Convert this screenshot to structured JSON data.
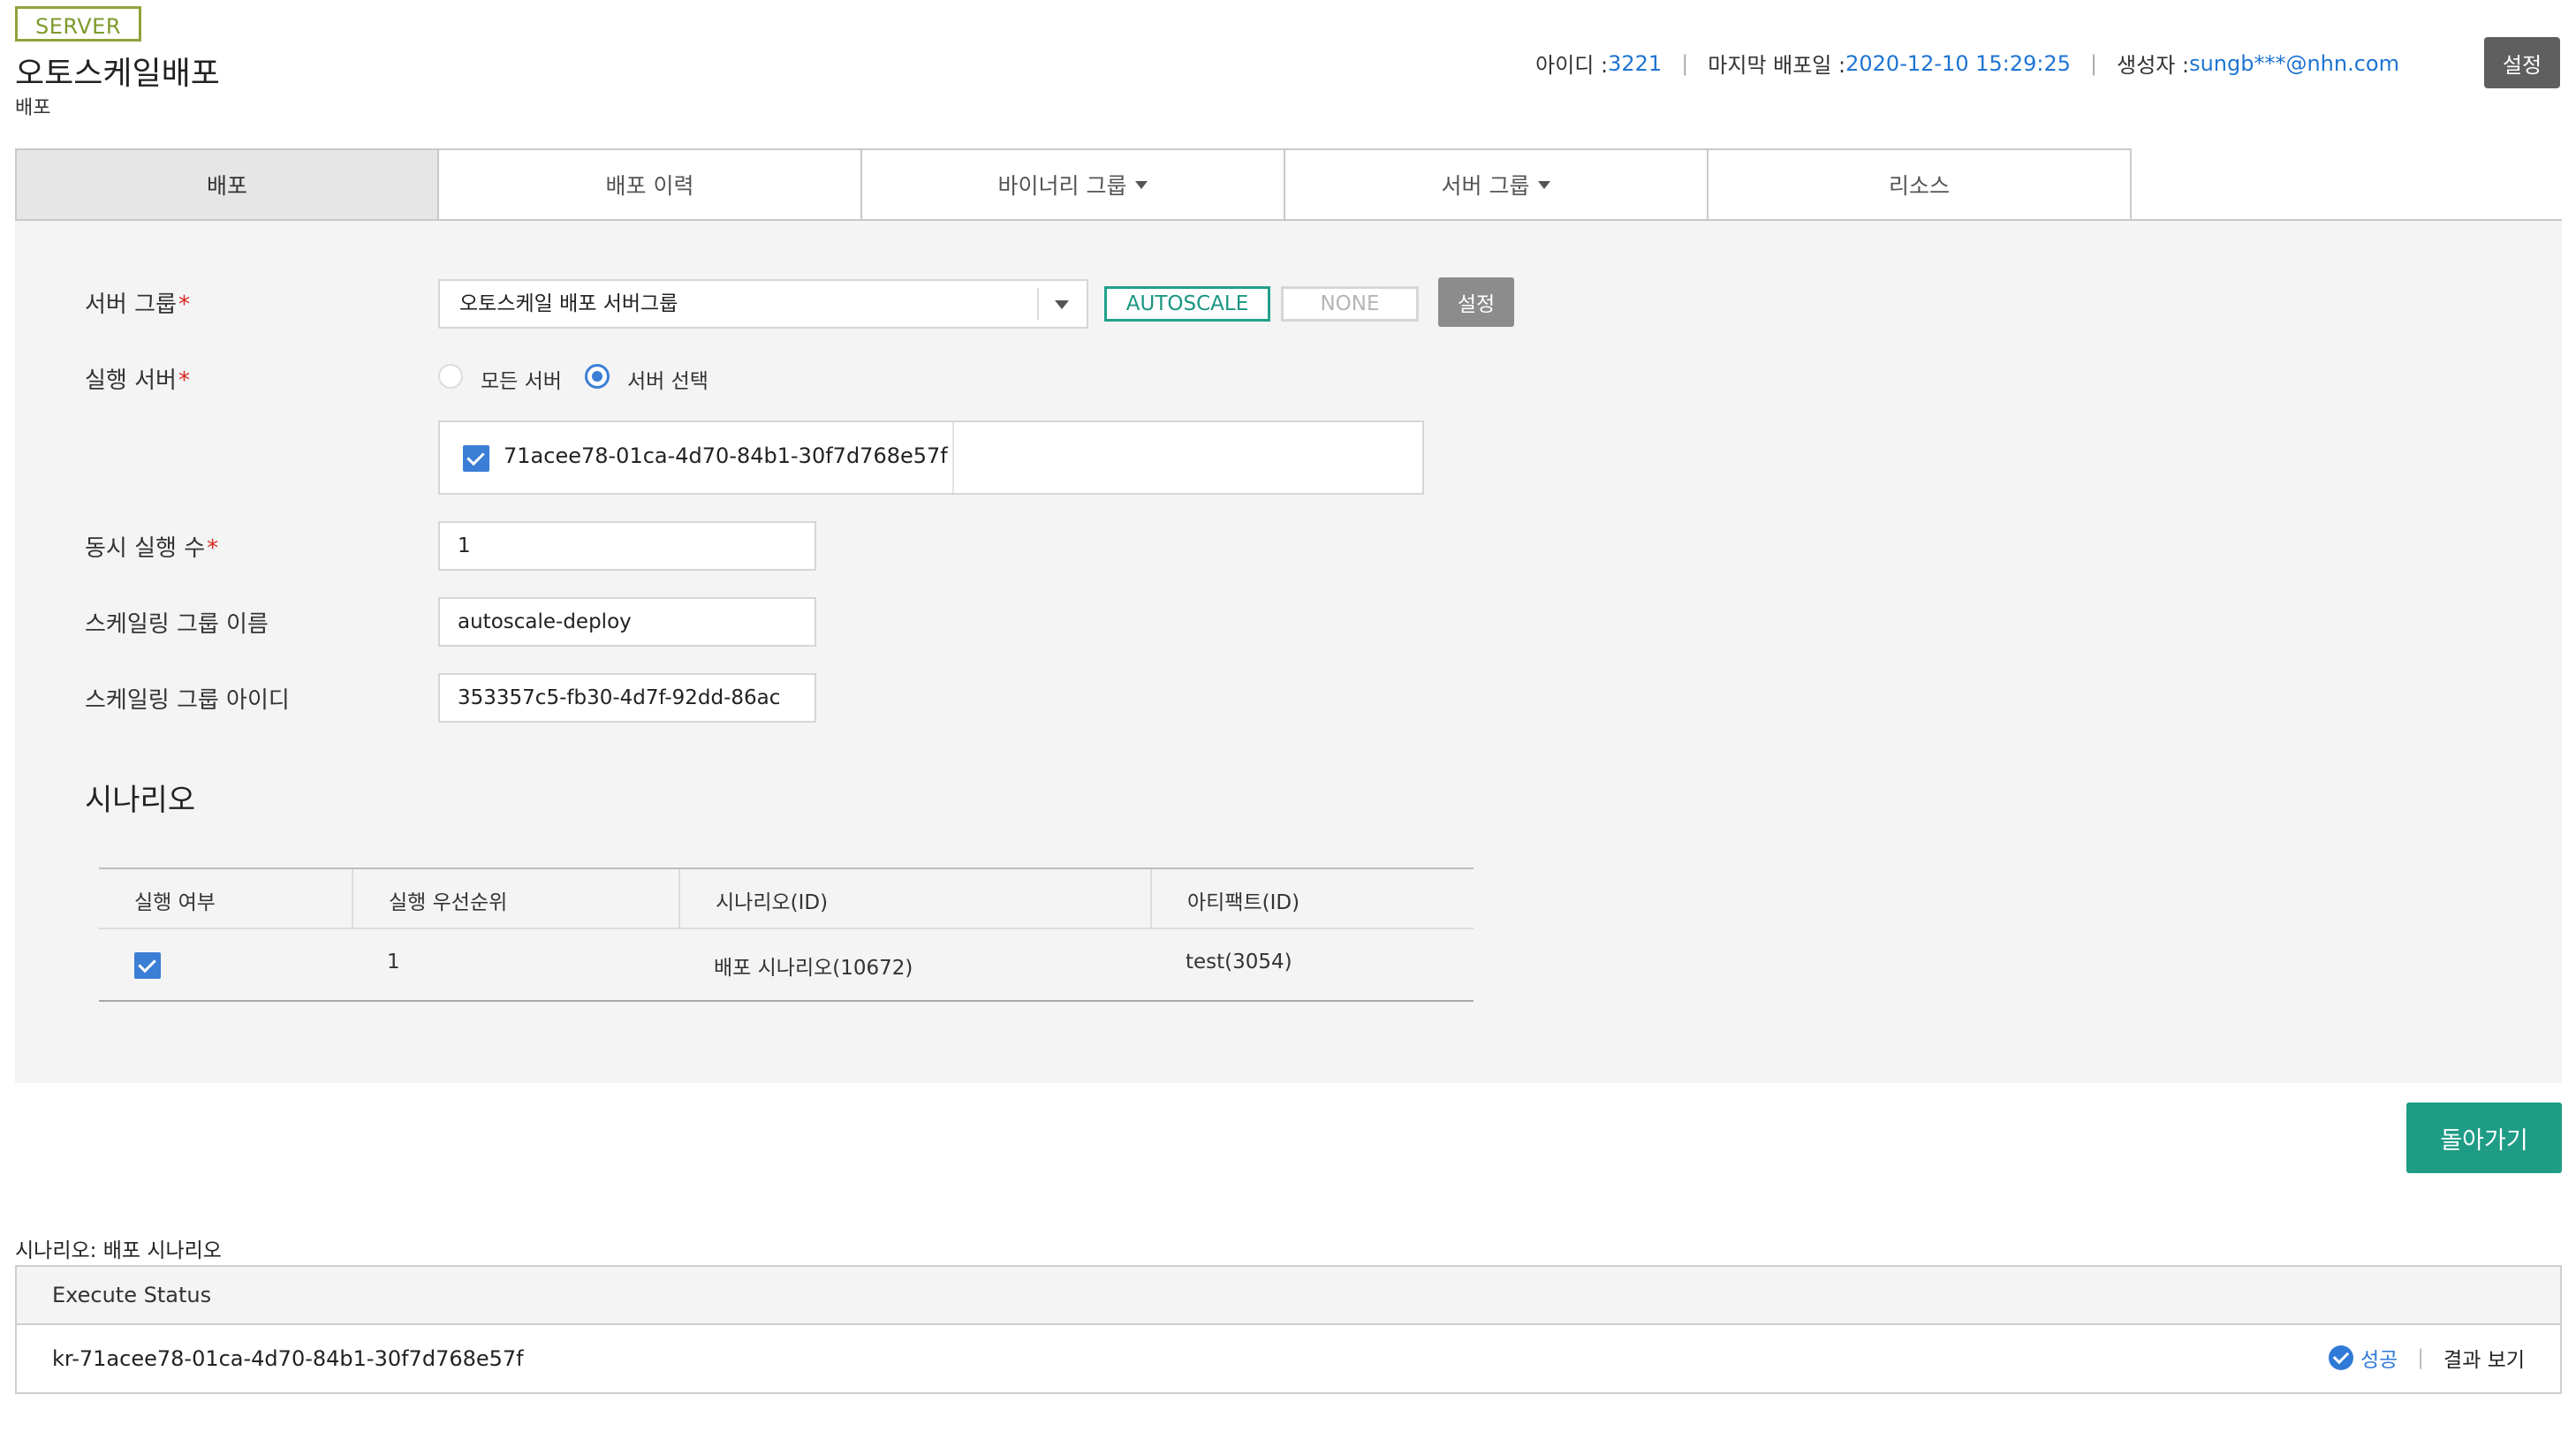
{
  "header": {
    "badge": "SERVER",
    "title": "오토스케일배포",
    "subtitle": "배포",
    "meta": {
      "id_label": "아이디 : ",
      "id_value": "3221",
      "last_deploy_label": "마지막 배포일 : ",
      "last_deploy_value": "2020-12-10 15:29:25",
      "creator_label": "생성자 : ",
      "creator_value": "sungb***@nhn.com"
    },
    "settings_label": "설정"
  },
  "tabs": [
    {
      "label": "배포"
    },
    {
      "label": "배포 이력"
    },
    {
      "label": "바이너리 그룹"
    },
    {
      "label": "서버 그룹"
    },
    {
      "label": "리소스"
    }
  ],
  "form": {
    "server_group_label": "서버 그룹",
    "server_group_value": "오토스케일 배포 서버그룹",
    "autoscale_label": "AUTOSCALE",
    "none_label": "NONE",
    "set_label": "설정",
    "exec_server_label": "실행 서버",
    "radio_all": "모든 서버",
    "radio_select": "서버 선택",
    "server_id": "71acee78-01ca-4d70-84b1-30f7d768e57f",
    "concurrency_label": "동시 실행 수",
    "concurrency_value": "1",
    "scaling_name_label": "스케일링 그룹 이름",
    "scaling_name_value": "autoscale-deploy",
    "scaling_id_label": "스케일링 그룹 아이디",
    "scaling_id_value": "353357c5-fb30-4d7f-92dd-86ac",
    "required_mark": "*"
  },
  "scenario": {
    "title": "시나리오",
    "columns": [
      "실행 여부",
      "실행 우선순위",
      "시나리오(ID)",
      "아티팩트(ID)"
    ],
    "rows": [
      {
        "priority": "1",
        "scenario": "배포 시나리오(10672)",
        "artifact": "test(3054)"
      }
    ]
  },
  "back_label": "돌아가기",
  "execution": {
    "caption": "시나리오: 배포 시나리오",
    "header": "Execute Status",
    "host": "kr-71acee78-01ca-4d70-84b1-30f7d768e57f",
    "status": "성공",
    "result_link": "결과 보기"
  },
  "colors": {
    "accent_teal": "#1f9c85",
    "link_blue": "#1e74d2",
    "badge_green": "#8da33a",
    "required_red": "#d9261c"
  }
}
